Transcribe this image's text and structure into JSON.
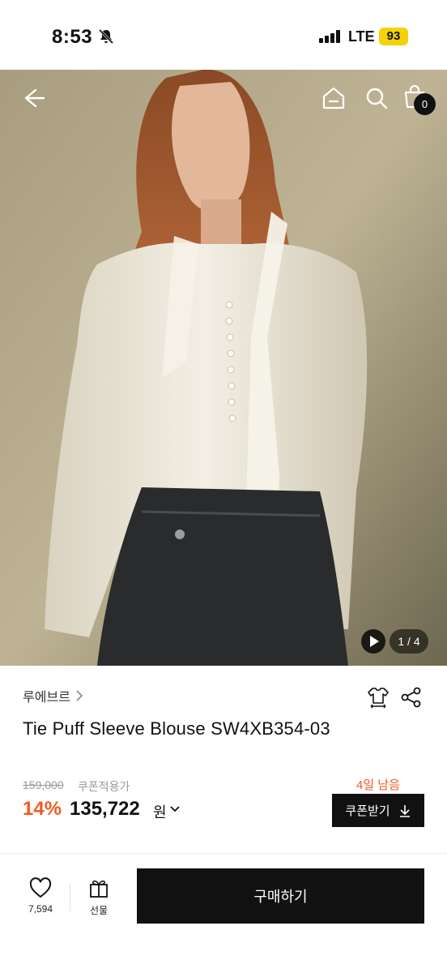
{
  "status": {
    "time": "8:53",
    "network": "LTE",
    "battery": "93"
  },
  "header": {
    "cart_count": "0"
  },
  "gallery": {
    "page": "1 / 4"
  },
  "product": {
    "brand": "루에브르",
    "title": "Tie Puff Sleeve Blouse SW4XB354-03",
    "original_price": "159,000",
    "coupon_price_label": "쿠폰적용가",
    "discount": "14%",
    "price": "135,722",
    "currency": "원",
    "days_left": "4일 남음",
    "coupon_button": "쿠폰받기"
  },
  "bottom_bar": {
    "like_count": "7,594",
    "gift_label": "선물",
    "buy_label": "구매하기"
  },
  "colors": {
    "accent": "#f25a20",
    "primary": "#111111"
  }
}
